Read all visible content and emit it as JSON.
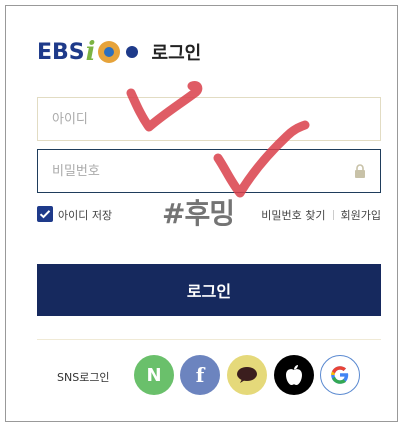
{
  "brand": {
    "logo_text": "EBS",
    "logo_i": "i",
    "title": "로그인"
  },
  "form": {
    "id_placeholder": "아이디",
    "pw_placeholder": "비밀번호",
    "remember_label": "아이디 저장",
    "remember_checked": true,
    "find_pw_label": "비밀번호 찾기",
    "signup_label": "회원가입",
    "login_button": "로그인"
  },
  "overlay": {
    "watermark": "#후밍"
  },
  "sns": {
    "label": "SNS로그인",
    "naver_glyph": "N",
    "facebook_glyph": "f",
    "google_glyph": "G",
    "icons": [
      "naver-icon",
      "facebook-icon",
      "kakao-icon",
      "apple-icon",
      "google-icon"
    ]
  },
  "colors": {
    "primary": "#16295e",
    "naver": "#6ac06b",
    "facebook": "#6c84bf",
    "kakao": "#e5d97a",
    "apple": "#000000",
    "annotation": "#d9404a"
  }
}
